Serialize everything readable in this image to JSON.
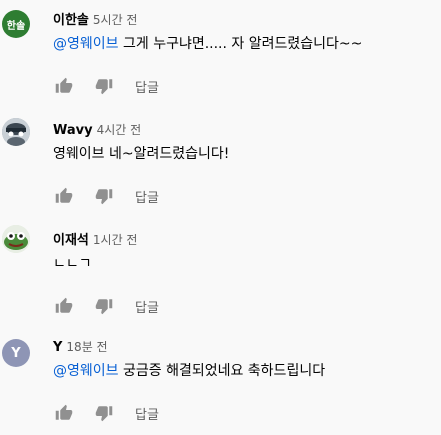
{
  "comments": [
    {
      "author": "이한솔",
      "time": "5시간 전",
      "avatar_text": "한솔",
      "avatar_color": "#2e7d32",
      "mention": "@영웨이브",
      "text": " 그게 누구냐면..... 자 알려드렸습니다~~",
      "reply_label": "답글"
    },
    {
      "author": "Wavy",
      "time": "4시간 전",
      "avatar_text": "",
      "avatar_color": "#9aa3ab",
      "mention": "",
      "text": "영웨이브 네~알려드렸습니다!",
      "reply_label": "답글"
    },
    {
      "author": "이재석",
      "time": "1시간 전",
      "avatar_text": "",
      "avatar_color": "#dbe7d5",
      "mention": "",
      "text": "ㄴㄴㄱ",
      "reply_label": "답글"
    },
    {
      "author": "Y",
      "time": "18분 전",
      "avatar_text": "Y",
      "avatar_color": "#8e95b5",
      "mention": "@영웨이브",
      "text": " 궁금증 해결되었네요 축하드립니다",
      "reply_label": "답글"
    }
  ],
  "icons": {
    "like": "thumbs-up-icon",
    "dislike": "thumbs-down-icon"
  },
  "colors": {
    "background": "#f9f9f9",
    "mention": "#065fd4",
    "secondary_text": "#606060",
    "icon": "#909090"
  }
}
